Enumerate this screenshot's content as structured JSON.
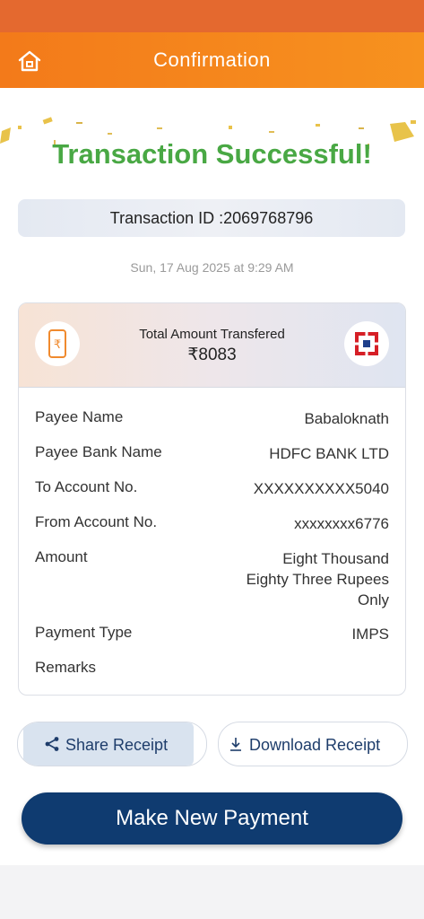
{
  "appbar": {
    "title": "Confirmation",
    "home_icon": "home-icon"
  },
  "status": {
    "headline": "Transaction Successful!",
    "transaction_id": "Transaction ID :2069768796",
    "datetime": "Sun, 17 Aug 2025 at 9:29 AM"
  },
  "card": {
    "label": "Total Amount Transfered",
    "amount": "₹8083",
    "rows": [
      {
        "key": "Payee Name",
        "value": "Babaloknath"
      },
      {
        "key": "Payee Bank Name",
        "value": "HDFC BANK LTD"
      },
      {
        "key": "To Account No.",
        "value": "XXXXXXXXXX5040"
      },
      {
        "key": "From Account No.",
        "value": "xxxxxxxx6776"
      },
      {
        "key": "Amount",
        "value_lines": [
          "Eight Thousand",
          "Eighty Three Rupees",
          "Only"
        ]
      },
      {
        "key": "Payment Type",
        "value": "IMPS"
      },
      {
        "key": "Remarks",
        "value": ""
      }
    ]
  },
  "actions": {
    "share": "Share Receipt",
    "download": "Download Receipt",
    "new_payment": "Make New Payment"
  },
  "colors": {
    "status_bar": "#e4692f",
    "appbar": "#f7921f",
    "success": "#49a844",
    "primary": "#0f3b70",
    "hdfc_red": "#d61f26",
    "hdfc_blue": "#1e3f8b"
  }
}
